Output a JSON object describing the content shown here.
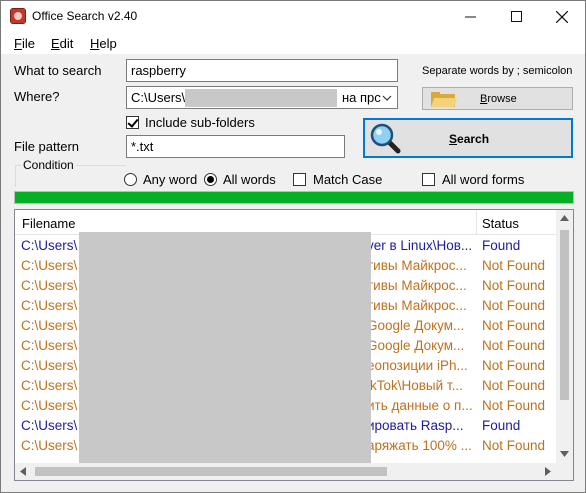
{
  "window": {
    "title": "Office Search v2.40"
  },
  "menu": {
    "file": "File",
    "edit": "Edit",
    "help": "Help"
  },
  "form": {
    "what_label": "What to search",
    "what_value": "raspberry",
    "where_label": "Where?",
    "where_value_start": "C:\\Users\\",
    "where_value_end": "на прс",
    "include_subfolders_label": "Include sub-folders",
    "include_subfolders_checked": true,
    "pattern_label": "File pattern",
    "pattern_value": "*.txt",
    "separator_hint": "Separate words by ; semicolon",
    "browse_label": "Browse",
    "search_label": "Search"
  },
  "condition": {
    "title": "Condition",
    "any_word": "Any word",
    "all_words": "All words",
    "selected": "all_words",
    "match_case": "Match Case",
    "match_case_checked": false,
    "all_word_forms": "All word forms",
    "all_word_forms_checked": false
  },
  "progress": {
    "percent": 100,
    "color": "#06b025"
  },
  "results": {
    "columns": {
      "filename": "Filename",
      "status": "Status"
    },
    "colors": {
      "found": "#1c1c9c",
      "not_found": "#c0711b"
    },
    "rows": [
      {
        "start": "C:\\Users\\",
        "tail": "ver в Linux\\Нов...",
        "status": "Found",
        "found": true
      },
      {
        "start": "C:\\Users\\",
        "tail": "тивы Майкрос...",
        "status": "Not Found",
        "found": false
      },
      {
        "start": "C:\\Users\\",
        "tail": "тивы Майкрос...",
        "status": "Not Found",
        "found": false
      },
      {
        "start": "C:\\Users\\",
        "tail": "тивы Майкрос...",
        "status": "Not Found",
        "found": false
      },
      {
        "start": "C:\\Users\\",
        "tail": "Google Докум...",
        "status": "Not Found",
        "found": false
      },
      {
        "start": "C:\\Users\\",
        "tail": "Google Докум...",
        "status": "Not Found",
        "found": false
      },
      {
        "start": "C:\\Users\\",
        "tail": "еопозиции iPh...",
        "status": "Not Found",
        "found": false
      },
      {
        "start": "C:\\Users\\",
        "tail": "ikTok\\Новый т...",
        "status": "Not Found",
        "found": false
      },
      {
        "start": "C:\\Users\\",
        "tail": "ить данные о п...",
        "status": "Not Found",
        "found": false
      },
      {
        "start": "C:\\Users\\",
        "tail": "ировать Rasp...",
        "status": "Found",
        "found": true
      },
      {
        "start": "C:\\Users\\",
        "tail": "аряжать 100% ...",
        "status": "Not Found",
        "found": false
      }
    ]
  }
}
